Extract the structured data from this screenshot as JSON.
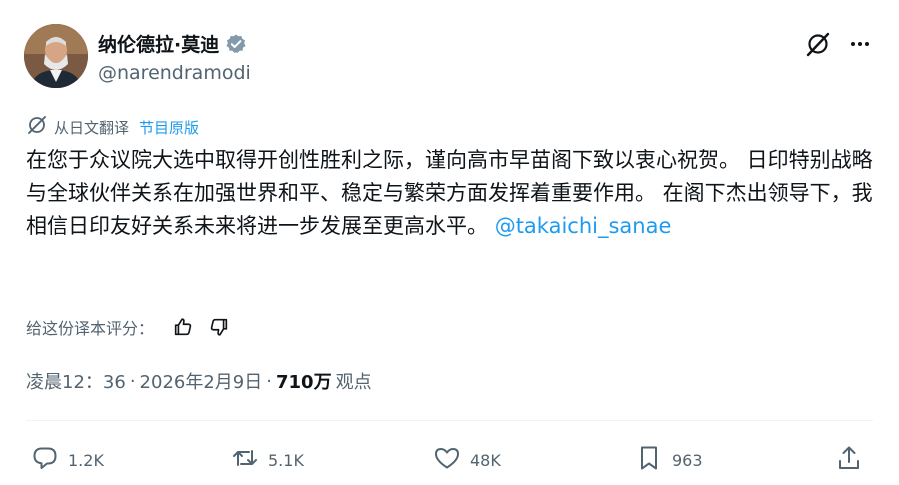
{
  "author": {
    "display_name": "纳伦德拉·莫迪",
    "handle": "@narendramodi"
  },
  "translation": {
    "label": "从日文翻译",
    "show_original": "节目原版"
  },
  "tweet": {
    "body": "在您于众议院大选中取得开创性胜利之际，谨向高市早苗阁下致以衷心祝贺。 日印特别战略与全球伙伴关系在加强世界和平、稳定与繁荣方面发挥着重要作用。 在阁下杰出领导下，我相信日印友好关系未来将进一步发展至更高水平。",
    "mention": "@takaichi_sanae"
  },
  "rating": {
    "label": "给这份译本评分："
  },
  "meta": {
    "time": "凌晨12：36",
    "sep1": "·",
    "date": "2026年2月9日",
    "sep2": "·",
    "views": "710万",
    "views_label": "观点"
  },
  "actions": {
    "replies": "1.2K",
    "reposts": "5.1K",
    "likes": "48K",
    "bookmarks": "963"
  },
  "colors": {
    "accent": "#1d9bf0",
    "secondary_text": "#536471",
    "primary_text": "#0f1419"
  },
  "icons": {
    "verified": "verified-badge-icon",
    "grok": "grok-icon",
    "more": "more-icon",
    "translate": "translate-icon",
    "thumbs_up": "thumbs-up-icon",
    "thumbs_down": "thumbs-down-icon",
    "reply": "reply-icon",
    "repost": "repost-icon",
    "like": "heart-icon",
    "bookmark": "bookmark-icon",
    "share": "share-icon"
  }
}
